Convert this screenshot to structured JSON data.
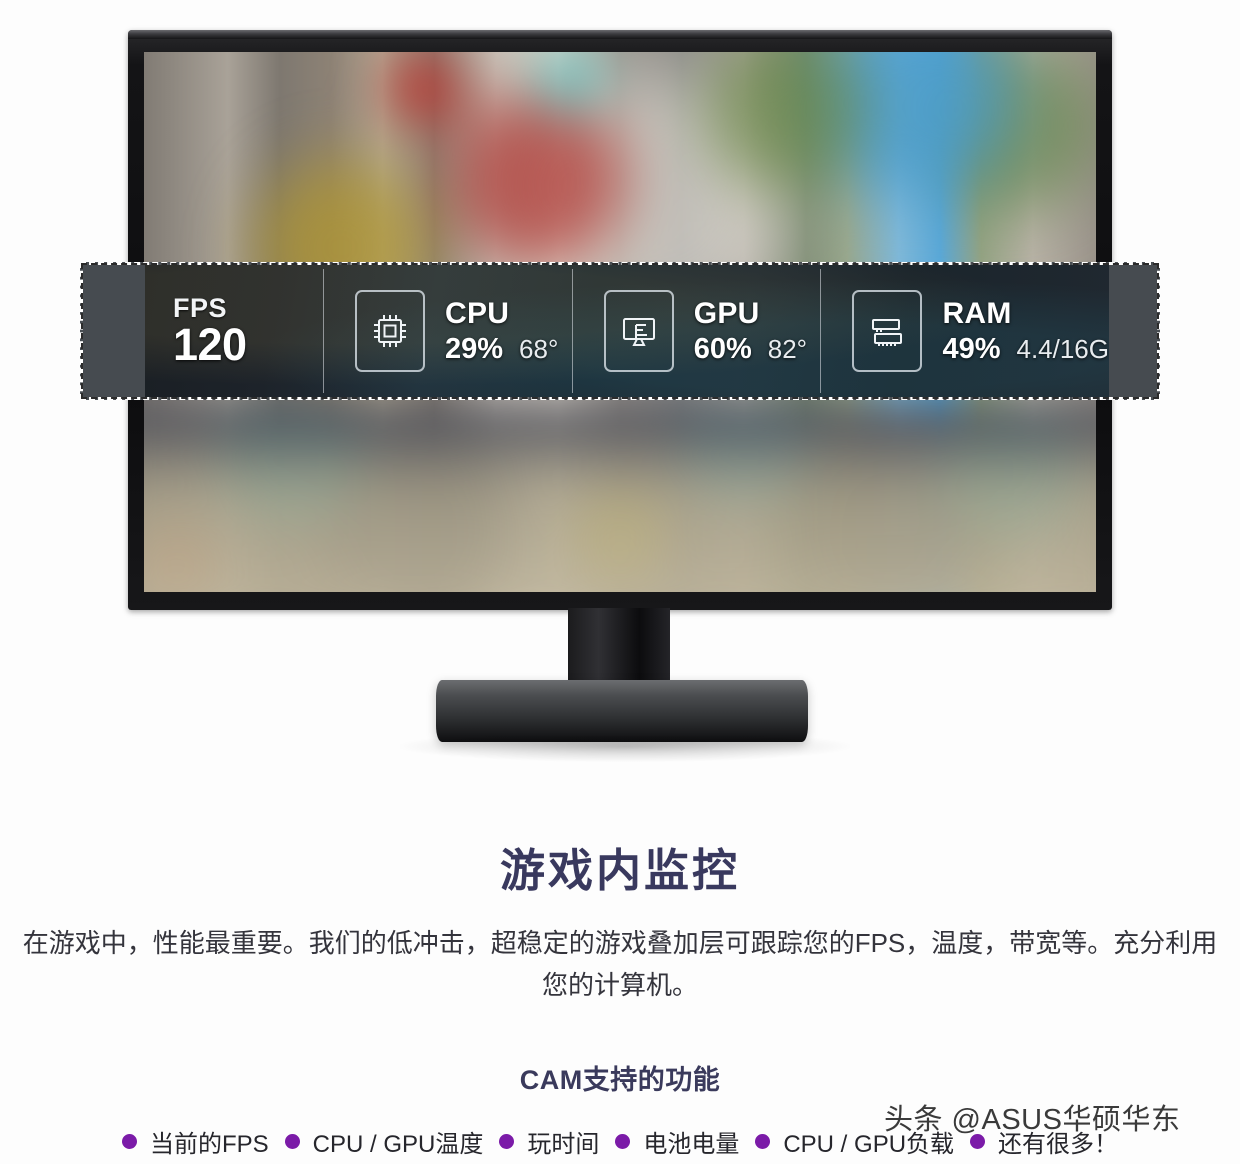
{
  "overlay": {
    "fps": {
      "label": "FPS",
      "value": "120"
    },
    "metrics": [
      {
        "icon": "cpu-chip-icon",
        "name": "CPU",
        "primary": "29%",
        "secondary": "68°"
      },
      {
        "icon": "gpu-monitor-icon",
        "name": "GPU",
        "primary": "60%",
        "secondary": "82°"
      },
      {
        "icon": "ram-stick-icon",
        "name": "RAM",
        "primary": "49%",
        "secondary": "4.4/16G"
      }
    ]
  },
  "article": {
    "title": "游戏内监控",
    "description": "在游戏中，性能最重要。我们的低冲击，超稳定的游戏叠加层可跟踪您的FPS，温度，带宽等。充分利用您的计算机。",
    "features_title": "CAM支持的功能",
    "features": [
      "当前的FPS",
      "CPU / GPU温度",
      "玩时间",
      "电池电量",
      "CPU / GPU负载",
      "还有很多！"
    ]
  },
  "watermark": {
    "text": "头条 @ASUS华硕华东"
  },
  "colors": {
    "title": "#39395e",
    "bullet": "#7b1ba8",
    "overlay_extension": "#4a4f54",
    "background": "#fdfdfd"
  }
}
